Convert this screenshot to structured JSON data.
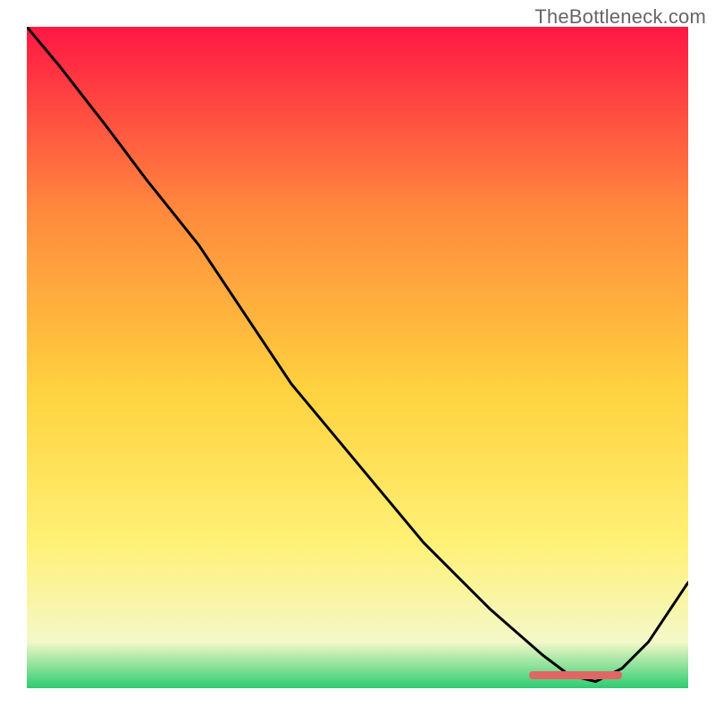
{
  "watermark": "TheBottleneck.com",
  "chart_data": {
    "type": "line",
    "title": "",
    "xlabel": "",
    "ylabel": "",
    "xlim": [
      0,
      1
    ],
    "ylim": [
      0,
      1
    ],
    "grid": false,
    "legend": false,
    "background_gradient": {
      "top": "#ff1744",
      "mid_upper": "#ff8a3d",
      "mid": "#ffd23f",
      "mid_lower": "#fff176",
      "near_bottom": "#f4f8c8",
      "bottom": "#2ecc71"
    },
    "marker": {
      "color": "#e06666",
      "x_start": 0.76,
      "x_end": 0.9,
      "y": 0.02
    },
    "series": [
      {
        "name": "curve",
        "color": "#000000",
        "x": [
          0.0,
          0.05,
          0.12,
          0.18,
          0.22,
          0.26,
          0.32,
          0.4,
          0.5,
          0.6,
          0.7,
          0.78,
          0.82,
          0.86,
          0.9,
          0.94,
          1.0
        ],
        "y": [
          1.0,
          0.94,
          0.85,
          0.77,
          0.72,
          0.67,
          0.58,
          0.46,
          0.34,
          0.22,
          0.12,
          0.05,
          0.02,
          0.01,
          0.03,
          0.07,
          0.16
        ]
      }
    ]
  }
}
